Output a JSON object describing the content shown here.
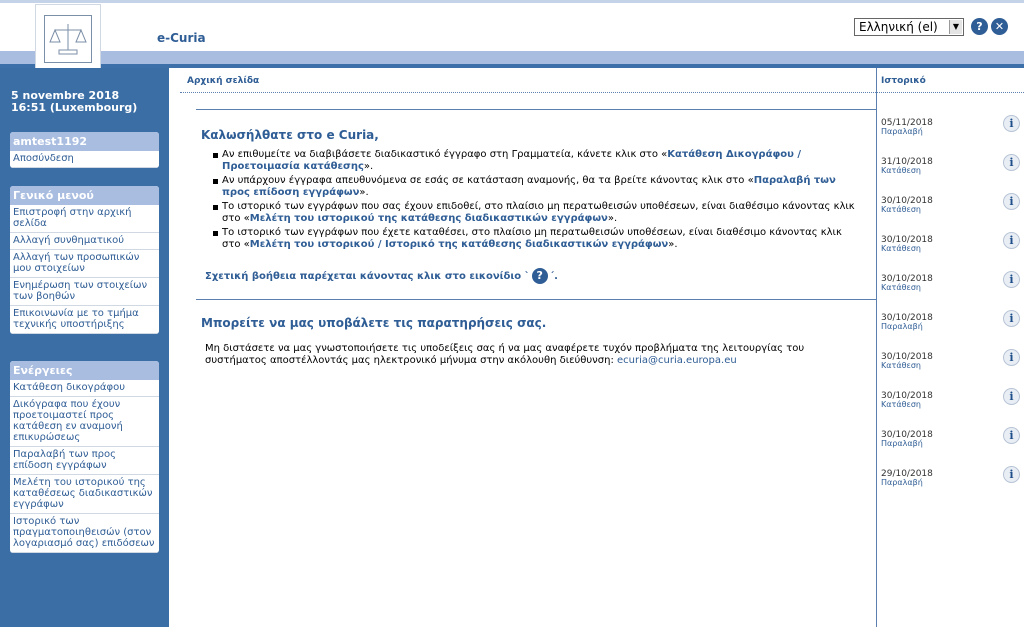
{
  "header": {
    "app_title": "e-Curia",
    "language": "Ελληνική (el)",
    "help_label": "?",
    "close_label": "✕"
  },
  "sidebar": {
    "date": "5 novembre 2018",
    "time": "16:51 (Luxembourg)",
    "user_box": {
      "title": "amtest1192",
      "items": [
        "Αποσύνδεση"
      ]
    },
    "general_menu": {
      "title": "Γενικό μενού",
      "items": [
        "Επιστροφή στην αρχική σελίδα",
        "Αλλαγή συνθηματικού",
        "Αλλαγή των προσωπικών μου στοιχείων",
        "Ενημέρωση των στοιχείων των βοηθών",
        "Επικοινωνία με το τμήμα τεχνικής υποστήριξης"
      ]
    },
    "actions": {
      "title": "Ενέργειες",
      "items": [
        "Κατάθεση δικογράφου",
        "Δικόγραφα που έχουν προετοιμαστεί προς κατάθεση εν αναμονή επικυρώσεως",
        "Παραλαβή των προς επίδοση εγγράφων",
        "Μελέτη του ιστορικού της καταθέσεως διαδικαστικών εγγράφων",
        "Ιστορικό των πραγματοποιηθεισών (στον λογαριασμό σας) επιδόσεων"
      ]
    }
  },
  "main": {
    "breadcrumb": "Αρχική σελίδα",
    "welcome": "Καλωσήλθατε στο e Curia,",
    "bullets": [
      {
        "text": "Αν επιθυμείτε να διαβιβάσετε διαδικαστικό έγγραφο στη Γραμματεία, κάνετε κλικ στο «",
        "link": "Κατάθεση Δικογράφου / Προετοιμασία κατάθεσης",
        "end": "»."
      },
      {
        "text": "Αν υπάρχουν έγγραφα απευθυνόμενα σε εσάς σε κατάσταση αναμονής, θα τα βρείτε κάνοντας κλικ στο «",
        "link": "Παραλαβή των προς επίδοση εγγράφων",
        "end": "»."
      },
      {
        "text": "Το ιστορικό των εγγράφων που σας έχουν επιδοθεί, στο πλαίσιο μη περατωθεισών υποθέσεων, είναι διαθέσιμο κάνοντας κλικ στο «",
        "link": "Μελέτη του ιστορικού της κατάθεσης διαδικαστικών εγγράφων",
        "end": "»."
      },
      {
        "text": "Το ιστορικό των εγγράφων που έχετε καταθέσει, στο πλαίσιο μη περατωθεισών υποθέσεων, είναι διαθέσιμο κάνοντας κλικ στο «",
        "link": "Μελέτη του ιστορικού / Ιστορικό της κατάθεσης διαδικαστικών εγγράφων",
        "end": "»."
      }
    ],
    "help_text": "Σχετική βοήθεια παρέχεται κάνοντας κλικ στο εικονίδιο `",
    "help_end": "΄.",
    "feedback_title": "Μπορείτε να μας υποβάλετε τις παρατηρήσεις σας.",
    "feedback_text": "Μη διστάσετε να μας γνωστοποιήσετε τις υποδείξεις σας ή να μας αναφέρετε τυχόν προβλήματα της λειτουργίας του συστήματος αποστέλλοντάς μας ηλεκτρονικό μήνυμα στην ακόλουθη διεύθυνση: ",
    "email": "ecuria@curia.europa.eu"
  },
  "history": {
    "title": "Ιστορικό",
    "entries": [
      {
        "date": "05/11/2018",
        "type": "Παραλαβή"
      },
      {
        "date": "31/10/2018",
        "type": "Κατάθεση"
      },
      {
        "date": "30/10/2018",
        "type": "Κατάθεση"
      },
      {
        "date": "30/10/2018",
        "type": "Κατάθεση"
      },
      {
        "date": "30/10/2018",
        "type": "Κατάθεση"
      },
      {
        "date": "30/10/2018",
        "type": "Παραλαβή"
      },
      {
        "date": "30/10/2018",
        "type": "Κατάθεση"
      },
      {
        "date": "30/10/2018",
        "type": "Κατάθεση"
      },
      {
        "date": "30/10/2018",
        "type": "Παραλαβή"
      },
      {
        "date": "29/10/2018",
        "type": "Παραλαβή"
      }
    ]
  }
}
